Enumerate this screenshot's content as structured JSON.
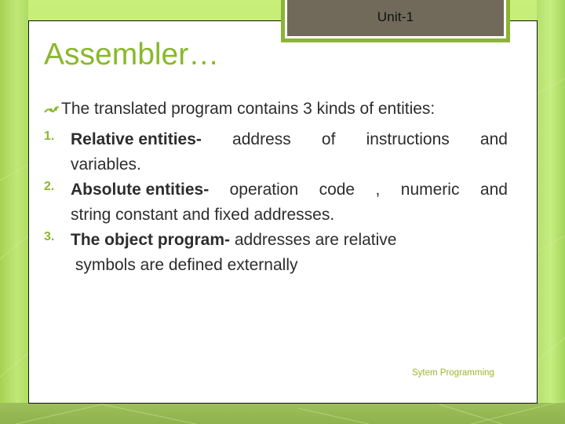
{
  "header": {
    "unit_label": "Unit-1"
  },
  "slide": {
    "title": "Assembler…",
    "intro": {
      "icon": "swirl-bullet-icon",
      "text": "The translated program contains 3 kinds of entities:"
    },
    "items": [
      {
        "number": "1.",
        "bold": "Relative entities-",
        "line1_words": [
          "address",
          "of",
          "instructions",
          "and"
        ],
        "line2": "variables."
      },
      {
        "number": "2.",
        "bold": "Absolute entities-",
        "line1_words": [
          "operation",
          "code",
          ",",
          "numeric",
          "and"
        ],
        "line2": "string constant and fixed addresses."
      },
      {
        "number": "3.",
        "bold": "The object program-",
        "line1_rest": " addresses are relative",
        "line2": " symbols are defined externally"
      }
    ],
    "footer": "Sytem Programming"
  },
  "colors": {
    "accent": "#8ab82a",
    "tab_fill": "#716959",
    "tab_border": "#8bb434",
    "text": "#2d2d2d"
  }
}
